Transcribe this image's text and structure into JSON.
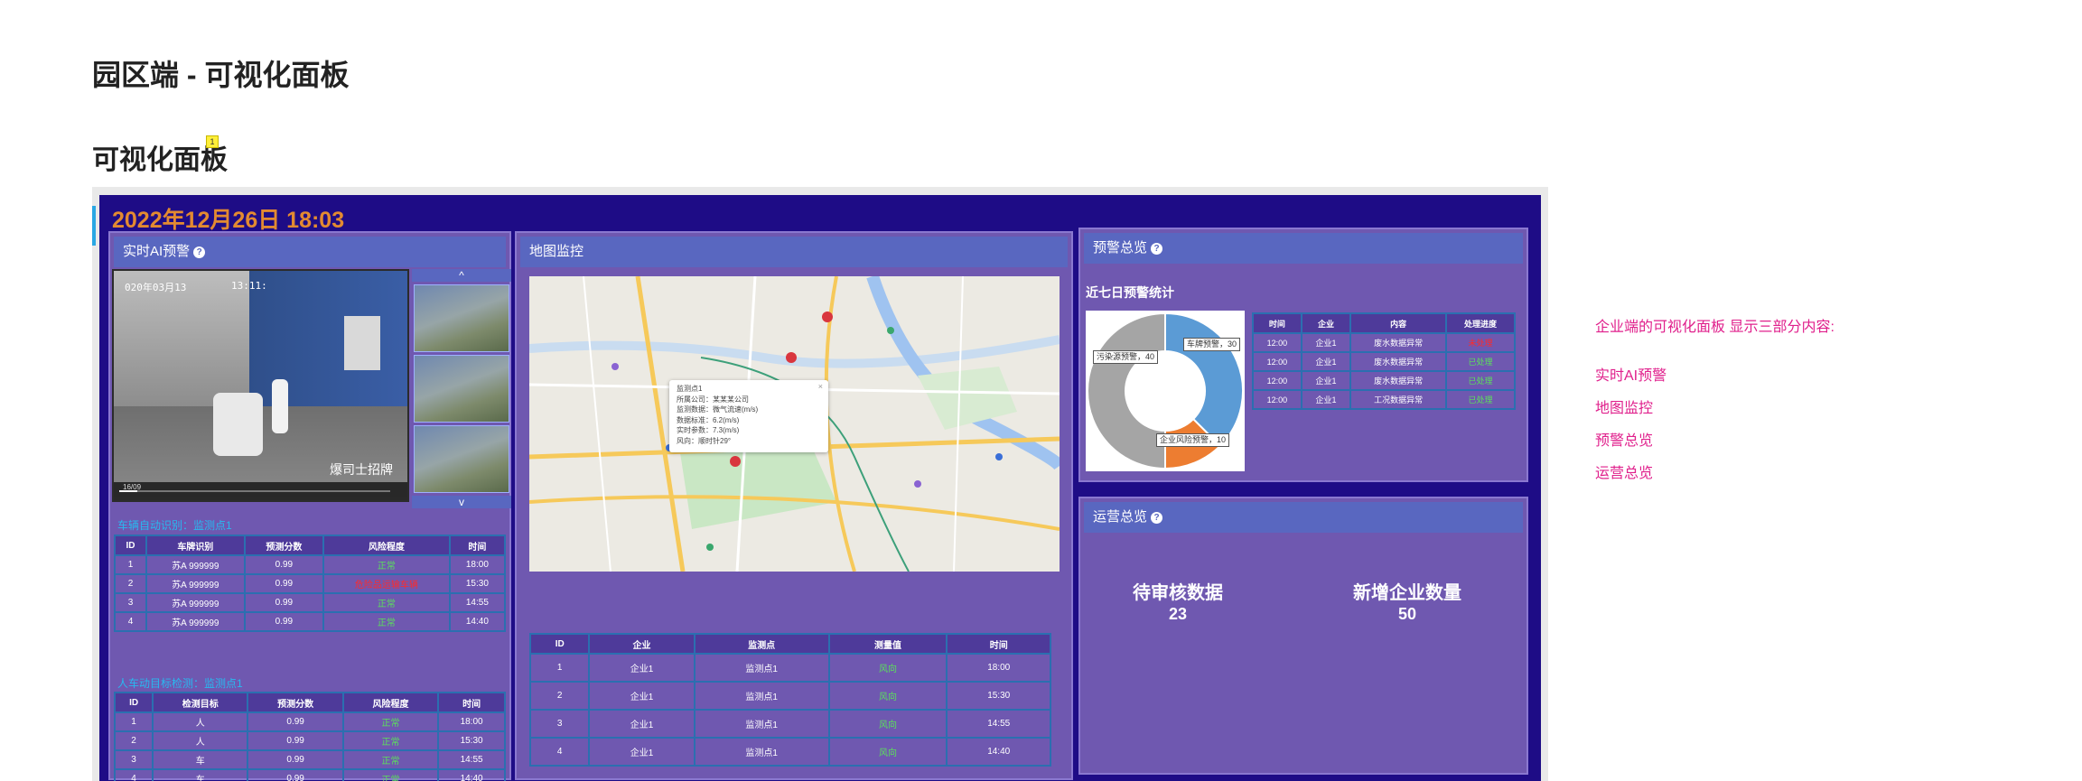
{
  "page": {
    "title": "园区端 - 可视化面板",
    "section_title": "可视化面板",
    "comment_marker": "1"
  },
  "dashboard": {
    "datetime": "2022年12月26日 18:03",
    "ai_panel": {
      "title": "实时AI预警",
      "video": {
        "timestamp": "020年03月13",
        "time": "13:11:",
        "duration": "16/09",
        "watermark": "爆司士招牌"
      },
      "thumb_up": "^",
      "thumb_down": "v",
      "plate_section": "车辆自动识别：监测点1",
      "plate_table": {
        "headers": [
          "ID",
          "车牌识别",
          "预测分数",
          "风险程度",
          "时间"
        ],
        "rows": [
          [
            "1",
            "苏A 999999",
            "0.99",
            "正常",
            "18:00"
          ],
          [
            "2",
            "苏A 999999",
            "0.99",
            "危险品运输车辆",
            "15:30"
          ],
          [
            "3",
            "苏A 999999",
            "0.99",
            "正常",
            "14:55"
          ],
          [
            "4",
            "苏A 999999",
            "0.99",
            "正常",
            "14:40"
          ]
        ]
      },
      "person_section": "人车动目标检测：监测点1",
      "person_table": {
        "headers": [
          "ID",
          "检测目标",
          "预测分数",
          "风险程度",
          "时间"
        ],
        "rows": [
          [
            "1",
            "人",
            "0.99",
            "正常",
            "18:00"
          ],
          [
            "2",
            "人",
            "0.99",
            "正常",
            "15:30"
          ],
          [
            "3",
            "车",
            "0.99",
            "正常",
            "14:55"
          ],
          [
            "4",
            "车",
            "0.99",
            "正常",
            "14:40"
          ]
        ]
      }
    },
    "map_panel": {
      "title": "地图监控",
      "popup": {
        "title": "监测点1",
        "lines": [
          "所属公司：某某某公司",
          "监测数据：微气流速(m/s)",
          "数据标准：6.2(m/s)",
          "实时参数：7.3(m/s)",
          "风向：顺时针29°"
        ]
      },
      "table": {
        "headers": [
          "ID",
          "企业",
          "监测点",
          "测量值",
          "时间"
        ],
        "rows": [
          [
            "1",
            "企业1",
            "监测点1",
            "风向",
            "18:00"
          ],
          [
            "2",
            "企业1",
            "监测点1",
            "风向",
            "15:30"
          ],
          [
            "3",
            "企业1",
            "监测点1",
            "风向",
            "14:55"
          ],
          [
            "4",
            "企业1",
            "监测点1",
            "风向",
            "14:40"
          ]
        ]
      }
    },
    "warning_panel": {
      "title": "预警总览",
      "subtitle": "近七日预警统计",
      "donut_labels": [
        "车牌预警，30",
        "污染源预警，40",
        "企业风险预警，10"
      ],
      "table": {
        "headers": [
          "时间",
          "企业",
          "内容",
          "处理进度"
        ],
        "rows": [
          [
            "12:00",
            "企业1",
            "废水数据异常",
            "未处理"
          ],
          [
            "12:00",
            "企业1",
            "废水数据异常",
            "已处理"
          ],
          [
            "12:00",
            "企业1",
            "废水数据异常",
            "已处理"
          ],
          [
            "12:00",
            "企业1",
            "工况数据异常",
            "已处理"
          ]
        ]
      }
    },
    "ops_panel": {
      "title": "运营总览",
      "stats": [
        {
          "label": "待审核数据",
          "value": "23"
        },
        {
          "label": "新增企业数量",
          "value": "50"
        }
      ]
    }
  },
  "chart_data": {
    "type": "pie",
    "categories": [
      "车牌预警",
      "企业风险预警",
      "污染源预警"
    ],
    "values": [
      30,
      10,
      40
    ],
    "colors": [
      "#5b9bd5",
      "#ed7d31",
      "#a5a5a5"
    ]
  },
  "notes": {
    "intro": "企业端的可视化面板 显示三部分内容:",
    "items": [
      "实时AI预警",
      "地图监控",
      "预警总览",
      "运营总览"
    ]
  }
}
